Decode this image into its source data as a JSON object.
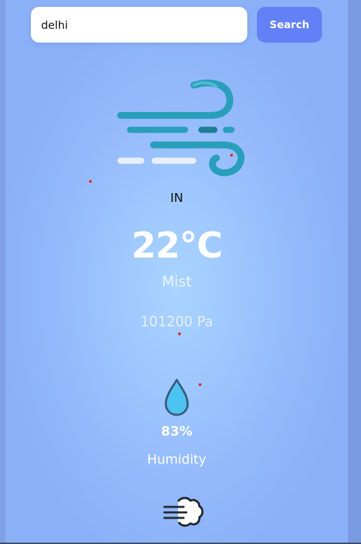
{
  "search": {
    "value": "delhi",
    "button_label": "Search"
  },
  "weather": {
    "icon": "wind-icon",
    "country": "IN",
    "temperature": "22°C",
    "condition": "Mist",
    "pressure": "101200 Pa"
  },
  "humidity": {
    "icon": "water-drop-icon",
    "value": "83%",
    "label": "Humidity"
  },
  "wind": {
    "icon": "wind-puff-icon"
  },
  "colors": {
    "background": "#9ec7fd",
    "search_button": "#6381f7",
    "icon_teal": "#2ea3bd",
    "drop_fill": "#4cc3f0",
    "drop_stroke": "#3a5a80",
    "dot": "#e2262d"
  }
}
